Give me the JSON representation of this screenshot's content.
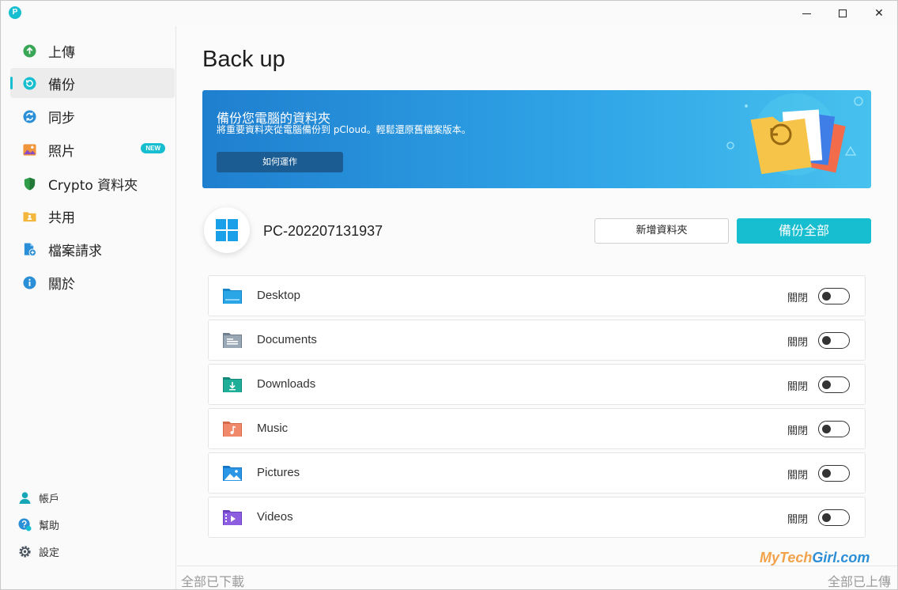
{
  "app": {
    "logo_letter": "P"
  },
  "window_controls": {
    "close": "✕"
  },
  "sidebar": {
    "items": [
      {
        "label": "上傳",
        "icon": "upload-icon",
        "color": "#3aa757",
        "active": false
      },
      {
        "label": "備份",
        "icon": "backup-icon",
        "color": "#17bed0",
        "active": true
      },
      {
        "label": "同步",
        "icon": "sync-icon",
        "color": "#2a8fd6",
        "active": false
      },
      {
        "label": "照片",
        "icon": "photos-icon",
        "color": "#f0953b",
        "active": false,
        "badge": "NEW"
      },
      {
        "label": "Crypto 資料夾",
        "icon": "crypto-shield-icon",
        "color": "#3aa757",
        "active": false
      },
      {
        "label": "共用",
        "icon": "shared-folder-icon",
        "color": "#f4b73d",
        "active": false
      },
      {
        "label": "檔案請求",
        "icon": "file-request-icon",
        "color": "#2a8fd6",
        "active": false
      },
      {
        "label": "關於",
        "icon": "info-icon",
        "color": "#2a8fd6",
        "active": false
      }
    ],
    "utility": [
      {
        "label": "帳戶",
        "icon": "account-icon"
      },
      {
        "label": "幫助",
        "icon": "help-icon"
      },
      {
        "label": "設定",
        "icon": "settings-icon"
      }
    ]
  },
  "main": {
    "title": "Back up",
    "banner": {
      "title": "備份您電腦的資料夾",
      "subtitle": "將重要資料夾從電腦備份到 pCloud。輕鬆還原舊檔案版本。",
      "button": "如何運作"
    },
    "computer_name": "PC-202207131937",
    "add_folder_button": "新增資料夾",
    "backup_all_button": "備份全部",
    "folders": [
      {
        "name": "Desktop",
        "icon": "desktop-folder-icon",
        "status": "關閉",
        "enabled": false
      },
      {
        "name": "Documents",
        "icon": "documents-folder-icon",
        "status": "關閉",
        "enabled": false
      },
      {
        "name": "Downloads",
        "icon": "downloads-folder-icon",
        "status": "關閉",
        "enabled": false
      },
      {
        "name": "Music",
        "icon": "music-folder-icon",
        "status": "關閉",
        "enabled": false
      },
      {
        "name": "Pictures",
        "icon": "pictures-folder-icon",
        "status": "關閉",
        "enabled": false
      },
      {
        "name": "Videos",
        "icon": "videos-folder-icon",
        "status": "關閉",
        "enabled": false
      }
    ]
  },
  "status_bar": {
    "left": "全部已下載",
    "right": "全部已上傳",
    "watermark_a": "MyTech",
    "watermark_b": "Girl.com"
  },
  "colors": {
    "accent": "#17bed0",
    "banner_button": "#1b5d93"
  }
}
